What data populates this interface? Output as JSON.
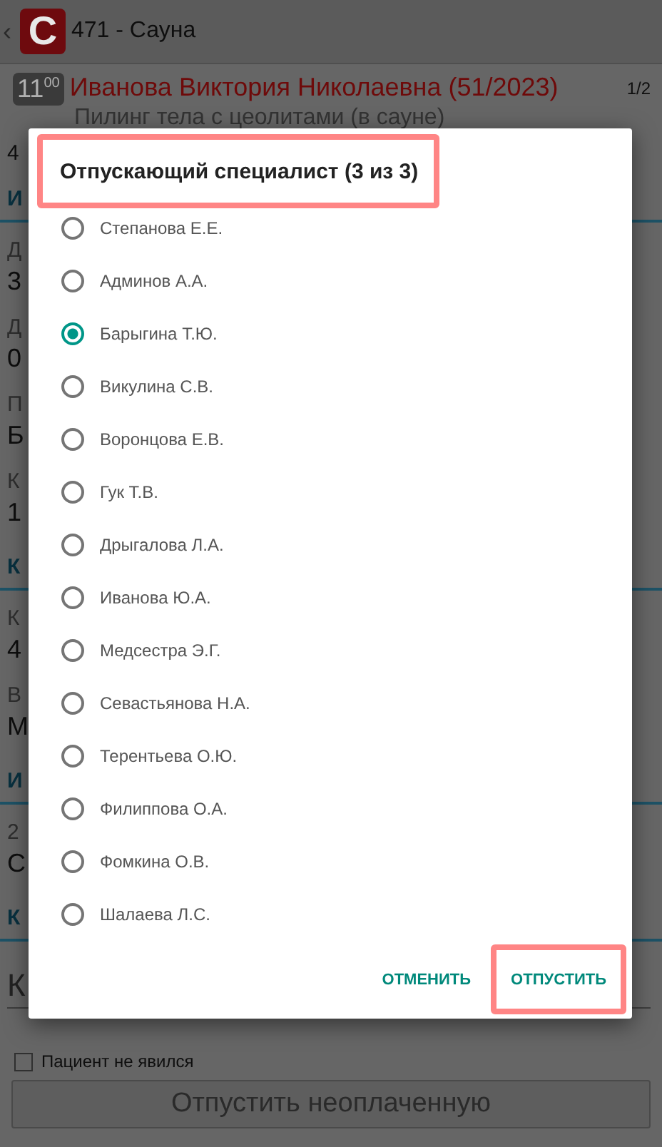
{
  "header": {
    "back": "‹",
    "logo_letter": "С",
    "title": "471 - Сауна"
  },
  "appointment": {
    "time_hours": "11",
    "time_minutes": "00",
    "patient": "Иванова Виктория Николаевна (51/2023)",
    "counter": "1/2",
    "service": "Пилинг тела с цеолитами (в сауне)"
  },
  "form_fragments": [
    {
      "kind": "row",
      "text": "4"
    },
    {
      "kind": "section",
      "text": "И"
    },
    {
      "kind": "label",
      "text": "Д"
    },
    {
      "kind": "value",
      "text": "3"
    },
    {
      "kind": "label",
      "text": "Д"
    },
    {
      "kind": "value",
      "text": "0"
    },
    {
      "kind": "label",
      "text": "П"
    },
    {
      "kind": "value",
      "text": "Б"
    },
    {
      "kind": "label",
      "text": "К"
    },
    {
      "kind": "value",
      "text": "1"
    },
    {
      "kind": "section",
      "text": "К"
    },
    {
      "kind": "label",
      "text": "К"
    },
    {
      "kind": "value",
      "text": "4"
    },
    {
      "kind": "label",
      "text": "В"
    },
    {
      "kind": "value",
      "text": "М"
    },
    {
      "kind": "section",
      "text": "И"
    },
    {
      "kind": "label",
      "text": "2"
    },
    {
      "kind": "value",
      "text": "С"
    },
    {
      "kind": "section",
      "text": "К"
    },
    {
      "kind": "field",
      "text": "К"
    }
  ],
  "no_show": {
    "label": "Пациент не явился",
    "checked": false
  },
  "unpaid_button": {
    "label": "Отпустить неоплаченную",
    "disabled": true
  },
  "dialog": {
    "title": "Отпускающий специалист (3 из 3)",
    "title_highlighted": true,
    "options": [
      {
        "label": "Степанова Е.Е.",
        "selected": false
      },
      {
        "label": "Админов А.А.",
        "selected": false
      },
      {
        "label": "Барыгина Т.Ю.",
        "selected": true
      },
      {
        "label": "Викулина С.В.",
        "selected": false
      },
      {
        "label": "Воронцова Е.В.",
        "selected": false
      },
      {
        "label": "Гук Т.В.",
        "selected": false
      },
      {
        "label": "Дрыгалова Л.А.",
        "selected": false
      },
      {
        "label": "Иванова Ю.А.",
        "selected": false
      },
      {
        "label": "Медсестра Э.Г.",
        "selected": false
      },
      {
        "label": "Севастьянова Н.А.",
        "selected": false
      },
      {
        "label": "Терентьева О.Ю.",
        "selected": false
      },
      {
        "label": "Филиппова О.А.",
        "selected": false
      },
      {
        "label": "Фомкина О.В.",
        "selected": false
      },
      {
        "label": "Шалаева Л.С.",
        "selected": false
      }
    ],
    "buttons": [
      {
        "label": "ОТМЕНИТЬ",
        "highlighted": false
      },
      {
        "label": "ОТПУСТИТЬ",
        "highlighted": true
      }
    ]
  }
}
